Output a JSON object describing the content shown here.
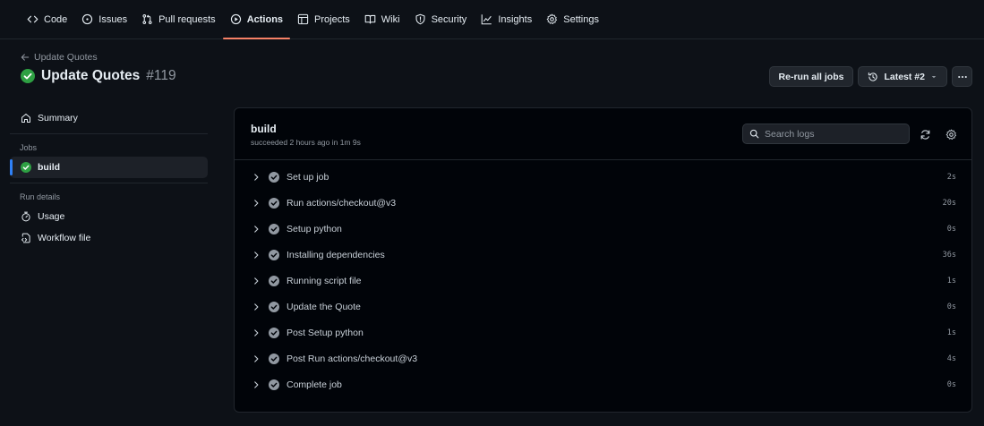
{
  "nav": {
    "tabs": [
      {
        "label": "Code",
        "icon": "code-icon"
      },
      {
        "label": "Issues",
        "icon": "issue-icon"
      },
      {
        "label": "Pull requests",
        "icon": "pull-request-icon"
      },
      {
        "label": "Actions",
        "icon": "play-icon",
        "active": true
      },
      {
        "label": "Projects",
        "icon": "table-icon"
      },
      {
        "label": "Wiki",
        "icon": "book-icon"
      },
      {
        "label": "Security",
        "icon": "shield-icon"
      },
      {
        "label": "Insights",
        "icon": "graph-icon"
      },
      {
        "label": "Settings",
        "icon": "gear-icon"
      }
    ]
  },
  "header": {
    "back_label": "Update Quotes",
    "title": "Update Quotes",
    "run_number": "#119",
    "rerun_label": "Re-run all jobs",
    "attempt_label": "Latest #2"
  },
  "sidebar": {
    "summary_label": "Summary",
    "jobs_heading": "Jobs",
    "job_label": "build",
    "run_details_heading": "Run details",
    "usage_label": "Usage",
    "workflow_file_label": "Workflow file"
  },
  "job": {
    "name": "build",
    "meta": "succeeded 2 hours ago in 1m 9s",
    "search_placeholder": "Search logs",
    "steps": [
      {
        "name": "Set up job",
        "duration": "2s"
      },
      {
        "name": "Run actions/checkout@v3",
        "duration": "20s"
      },
      {
        "name": "Setup python",
        "duration": "0s"
      },
      {
        "name": "Installing dependencies",
        "duration": "36s"
      },
      {
        "name": "Running script file",
        "duration": "1s"
      },
      {
        "name": "Update the Quote",
        "duration": "0s"
      },
      {
        "name": "Post Setup python",
        "duration": "1s"
      },
      {
        "name": "Post Run actions/checkout@v3",
        "duration": "4s"
      },
      {
        "name": "Complete job",
        "duration": "0s"
      }
    ]
  },
  "colors": {
    "success": "#2ea043",
    "accent_underline": "#f78166",
    "active_bar": "#2f81f7",
    "step_check": "#9198a1"
  }
}
